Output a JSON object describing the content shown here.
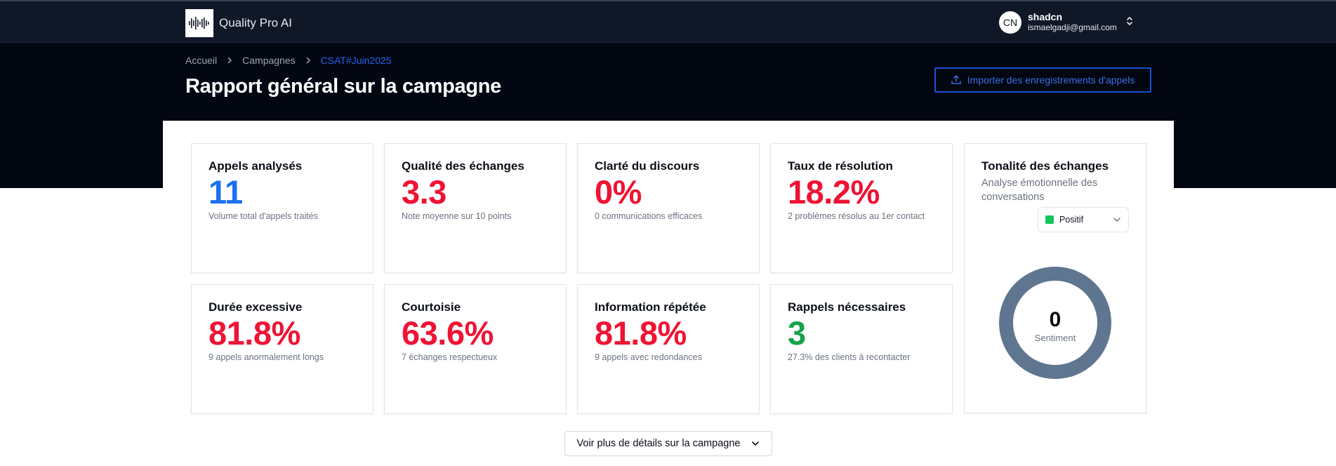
{
  "app": {
    "name": "Quality Pro AI",
    "logo_icon": "waveform-logo-icon"
  },
  "user": {
    "initials": "CN",
    "name": "shadcn",
    "email": "ismaelgadji@gmail.com"
  },
  "breadcrumb": {
    "items": [
      "Accueil",
      "Campagnes",
      "CSAT#Juin2025"
    ]
  },
  "page": {
    "title": "Rapport général sur la campagne"
  },
  "actions": {
    "import_label": "Importer des enregistrements d'appels",
    "more_details_label": "Voir plus de détails sur la campagne"
  },
  "metrics": [
    {
      "title": "Appels analysés",
      "value": "11",
      "desc": "Volume total d'appels traités",
      "color": "#1d6ff2"
    },
    {
      "title": "Qualité des échanges",
      "value": "3.3",
      "desc": "Note moyenne sur 10 points",
      "color": "#ef1333"
    },
    {
      "title": "Clarté du discours",
      "value": "0%",
      "desc": "0 communications efficaces",
      "color": "#ef1333"
    },
    {
      "title": "Taux de résolution",
      "value": "18.2%",
      "desc": "2 problèmes résolus au 1er contact",
      "color": "#ef1333"
    },
    {
      "title": "Durée excessive",
      "value": "81.8%",
      "desc": "9 appels anormalement longs",
      "color": "#ef1333"
    },
    {
      "title": "Courtoisie",
      "value": "63.6%",
      "desc": "7 échanges respectueux",
      "color": "#ef1333"
    },
    {
      "title": "Information répétée",
      "value": "81.8%",
      "desc": "9 appels avec redondances",
      "color": "#ef1333"
    },
    {
      "title": "Rappels nécessaires",
      "value": "3",
      "desc": "27.3% des clients à recontacter",
      "color": "#16a34a"
    }
  ],
  "tone": {
    "title": "Tonalité des échanges",
    "subtitle": "Analyse émotionnelle des conversations",
    "selected": "Positif",
    "selected_color": "#16c65a",
    "donut_value": "0",
    "donut_label": "Sentiment",
    "donut_color": "#5f7590"
  },
  "colors": {
    "topbar": "#101828",
    "hero": "#030712",
    "accent": "#1d4ed8"
  }
}
